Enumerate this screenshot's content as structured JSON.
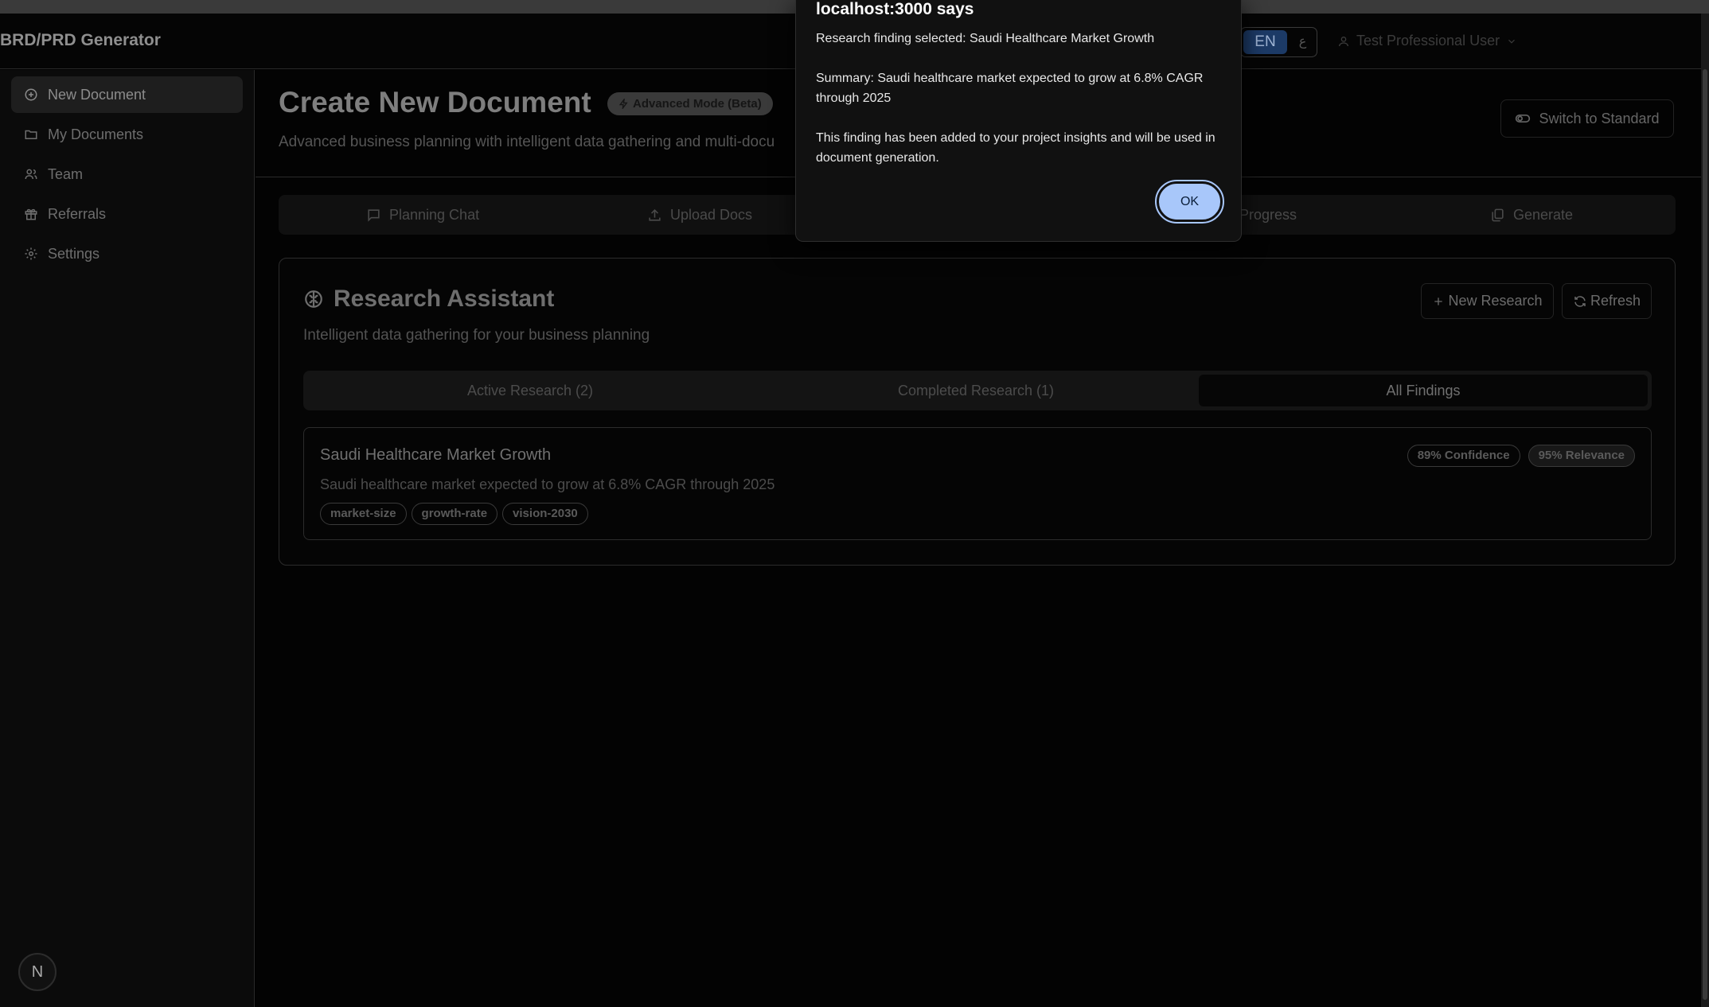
{
  "app": {
    "brand": "BRD/PRD Generator",
    "language": {
      "active": "EN",
      "other": "ع"
    },
    "user_name": "Test Professional User"
  },
  "sidebar": {
    "items": [
      {
        "label": "New Document",
        "icon": "plus-circle-icon",
        "active": true
      },
      {
        "label": "My Documents",
        "icon": "folder-icon",
        "active": false
      },
      {
        "label": "Team",
        "icon": "users-icon",
        "active": false
      },
      {
        "label": "Referrals",
        "icon": "gift-icon",
        "active": false
      },
      {
        "label": "Settings",
        "icon": "gear-icon",
        "active": false
      }
    ],
    "badge": "N"
  },
  "page": {
    "title": "Create New Document",
    "badge": "Advanced Mode (Beta)",
    "subtitle": "Advanced business planning with intelligent data gathering and multi-docu",
    "switch_label": "Switch to Standard",
    "tabs": [
      {
        "label": "Planning Chat",
        "icon": "message-square-icon"
      },
      {
        "label": "Upload Docs",
        "icon": "upload-icon"
      },
      {
        "label": "Progress",
        "icon": ""
      },
      {
        "label": "Generate",
        "icon": "files-icon"
      }
    ]
  },
  "research": {
    "title": "Research Assistant",
    "subtitle": "Intelligent data gathering for your business planning",
    "new_research_label": "New Research",
    "refresh_label": "Refresh",
    "segments": [
      {
        "label": "Active Research (2)",
        "active": false
      },
      {
        "label": "Completed Research (1)",
        "active": false
      },
      {
        "label": "All Findings",
        "active": true
      }
    ],
    "finding": {
      "title": "Saudi Healthcare Market Growth",
      "summary": "Saudi healthcare market expected to grow at 6.8% CAGR through 2025",
      "tags": [
        "market-size",
        "growth-rate",
        "vision-2030"
      ],
      "confidence": "89% Confidence",
      "relevance": "95% Relevance"
    }
  },
  "dialog": {
    "title": "localhost:3000 says",
    "line1": "Research finding selected: Saudi Healthcare Market Growth",
    "line2": "Summary: Saudi healthcare market expected to grow at 6.8% CAGR through 2025",
    "line3": "This finding has been added to your project insights and will be used in document generation.",
    "ok_label": "OK"
  },
  "colors": {
    "accent_button": "#a8c7fa",
    "language_active_bg": "#1c3a66",
    "background": "#000000"
  }
}
